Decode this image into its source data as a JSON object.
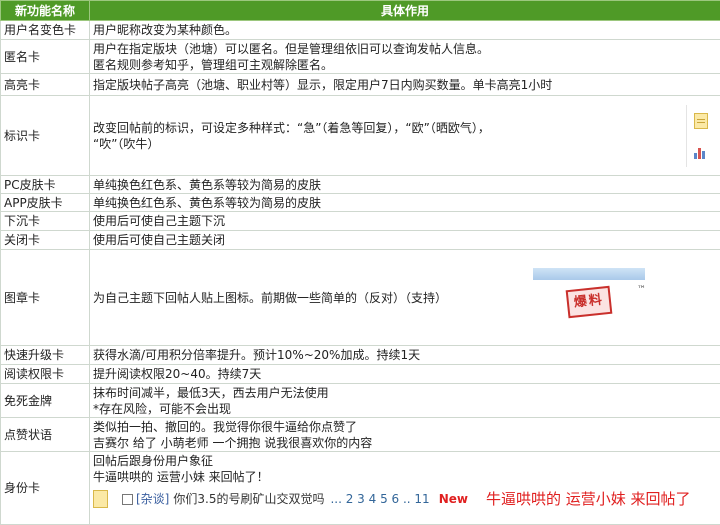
{
  "headers": {
    "name": "新功能名称",
    "effect": "具体作用"
  },
  "rows": [
    {
      "name": "用户名变色卡",
      "lines": [
        "用户昵称改变为某种颜色。"
      ]
    },
    {
      "name": "匿名卡",
      "lines": [
        "用户在指定版块（池塘）可以匿名。但是管理组依旧可以查询发帖人信息。",
        "匿名规则参考知乎，管理组可主观解除匿名。"
      ]
    },
    {
      "name": "高亮卡",
      "lines": [
        "指定版块帖子高亮（池塘、职业村等）显示，限定用户7日内购买数量。单卡高亮1小时"
      ]
    },
    {
      "name": "标识卡",
      "lines": [
        "改变回帖前的标识，可设定多种样式：“急”（着急等回复），“欧”（晒欧气），",
        "“吹”（吹牛）"
      ],
      "icons": [
        "document-icon",
        "bar-chart-icon"
      ]
    },
    {
      "name": "PC皮肤卡",
      "lines": [
        "单纯换色红色系、黄色系等较为简易的皮肤"
      ]
    },
    {
      "name": "APP皮肤卡",
      "lines": [
        "单纯换色红色系、黄色系等较为简易的皮肤"
      ]
    },
    {
      "name": "下沉卡",
      "lines": [
        "使用后可使自己主题下沉"
      ]
    },
    {
      "name": "关闭卡",
      "lines": [
        "使用后可使自己主题关闭"
      ]
    },
    {
      "name": "图章卡",
      "lines": [
        "为自己主题下回帖人贴上图标。前期做一些简单的（反对）（支持）"
      ],
      "stamp": {
        "text": "爆料",
        "mark": "™"
      }
    },
    {
      "name": "快速升级卡",
      "lines": [
        "获得水滴/可用积分倍率提升。预计10%~20%加成。持续1天"
      ]
    },
    {
      "name": "阅读权限卡",
      "lines": [
        "提升阅读权限20~40。持续7天"
      ]
    },
    {
      "name": "免死金牌",
      "lines": [
        "抹布时间减半，最低3天，西去用户无法使用",
        "*存在风险，可能不会出现"
      ]
    },
    {
      "name": "点赞状语",
      "lines": [
        "类似拍一拍、撤回的。我觉得你很牛逼给你点赞了",
        "吉赛尔 给了 小萌老师 一个拥抱 说我很喜欢你的内容"
      ]
    },
    {
      "name": "身份卡",
      "lines": [
        "回帖后跟身份用户象征",
        "牛逼哄哄的 运营小妹 来回帖了！"
      ]
    }
  ],
  "forum_line": {
    "tag": "[杂谈]",
    "thread": "你们3.5的号刷矿山交双觉吗",
    "pages": "... 2 3 4 5 6 .. 11",
    "new": "New",
    "promo": "牛逼哄哄的 运营小妹 来回帖了"
  },
  "colors": {
    "header_bg": "#4f9a27",
    "header_text": "#ffffff",
    "new": "#e02020",
    "promo": "#e02020"
  }
}
